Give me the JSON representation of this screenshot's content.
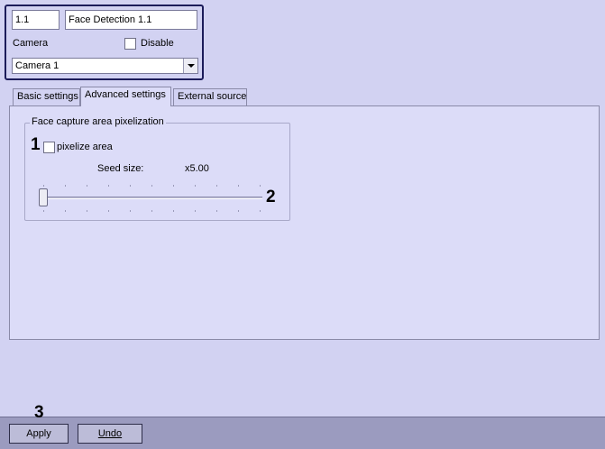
{
  "object": {
    "id": "1.1",
    "name": "Face Detection 1.1",
    "camera_label": "Camera",
    "disable_label": "Disable",
    "camera_selected": "Camera 1"
  },
  "tabs": [
    {
      "label": "Basic settings",
      "active": false
    },
    {
      "label": "Advanced settings",
      "active": true
    },
    {
      "label": "External source",
      "active": false
    }
  ],
  "pixelization": {
    "group_title": "Face capture area pixelization",
    "pixelize_label": "pixelize area",
    "pixelize_checked": false,
    "seed_label": "Seed size:",
    "seed_value": "x5.00"
  },
  "callouts": {
    "one": "1",
    "two": "2",
    "three": "3"
  },
  "footer": {
    "apply_label": "Apply",
    "undo_label": "Undo"
  }
}
